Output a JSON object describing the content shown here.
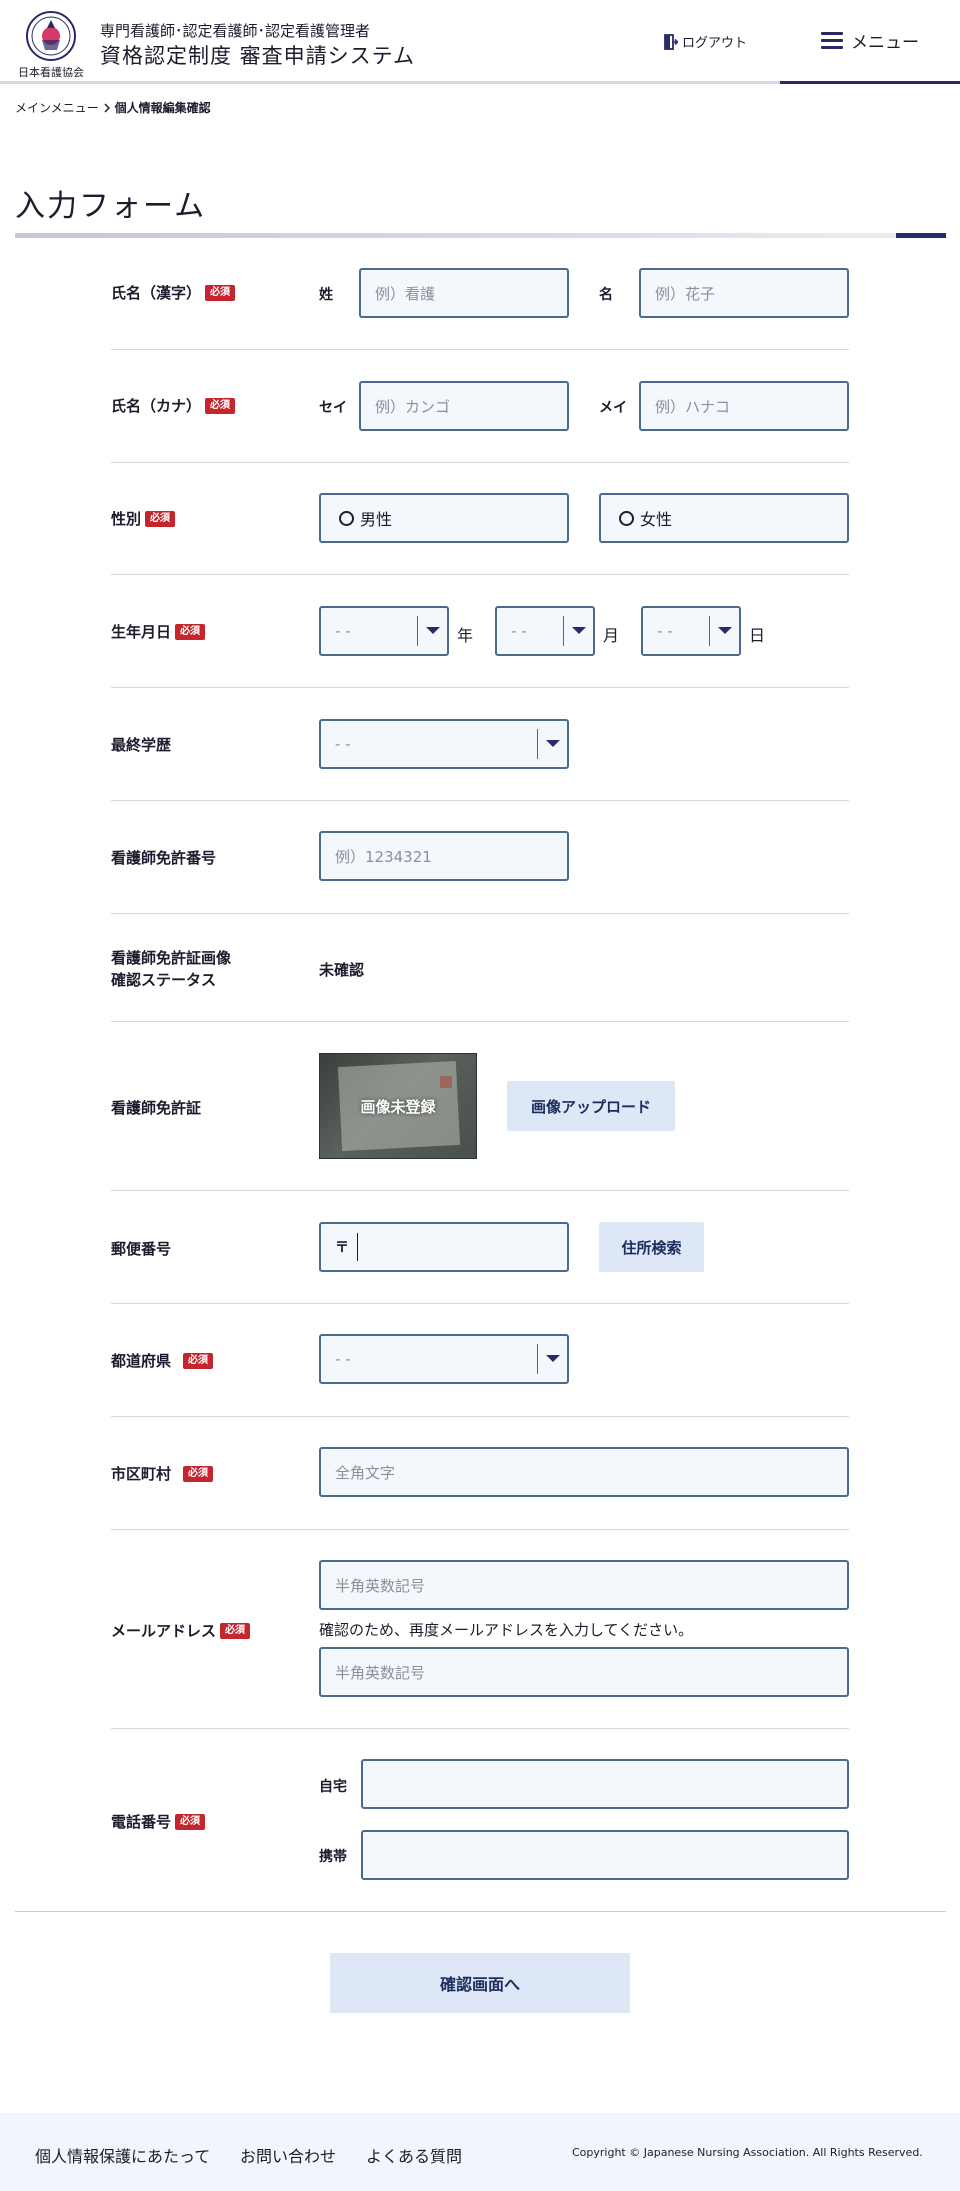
{
  "header": {
    "logo_text": "日本看護協会",
    "system_subtitle": "専門看護師･認定看護師･認定看護管理者",
    "system_title": "資格認定制度 審査申請システム",
    "logout_label": "ログアウト",
    "menu_label": "メニュー"
  },
  "breadcrumb": {
    "home": "メインメニュー",
    "current": "個人情報編集確認"
  },
  "page_title": "入力フォーム",
  "required_badge": "必須",
  "form": {
    "name_kanji": {
      "label": "氏名（漢字）",
      "last_label": "姓",
      "last_placeholder": "例）看護",
      "first_label": "名",
      "first_placeholder": "例）花子"
    },
    "name_kana": {
      "label": "氏名（カナ）",
      "last_label": "セイ",
      "last_placeholder": "例）カンゴ",
      "first_label": "メイ",
      "first_placeholder": "例）ハナコ"
    },
    "gender": {
      "label": "性別",
      "male": "男性",
      "female": "女性"
    },
    "birthdate": {
      "label": "生年月日",
      "year_value": "- -",
      "year_unit": "年",
      "month_value": "- -",
      "month_unit": "月",
      "day_value": "- -",
      "day_unit": "日"
    },
    "education": {
      "label": "最終学歴",
      "value": "- -"
    },
    "license_number": {
      "label": "看護師免許番号",
      "placeholder": "例）1234321"
    },
    "license_status": {
      "label_line1": "看護師免許証画像",
      "label_line2": "確認ステータス",
      "value": "未確認"
    },
    "license_image": {
      "label": "看護師免許証",
      "image_text": "画像未登録",
      "upload_button": "画像アップロード"
    },
    "postal": {
      "label": "郵便番号",
      "prefix": "〒",
      "search_button": "住所検索"
    },
    "prefecture": {
      "label": "都道府県",
      "value": "- -"
    },
    "city": {
      "label": "市区町村",
      "placeholder": "全角文字"
    },
    "email": {
      "label": "メールアドレス",
      "placeholder": "半角英数記号",
      "confirm_note": "確認のため、再度メールアドレスを入力してください。",
      "confirm_placeholder": "半角英数記号"
    },
    "phone": {
      "label": "電話番号",
      "home_label": "自宅",
      "mobile_label": "携帯"
    }
  },
  "confirm_button": "確認画面へ",
  "footer": {
    "links": [
      "個人情報保護にあたって",
      "お問い合わせ",
      "よくある質問"
    ],
    "copyright": "Copyright © Japanese Nursing Association. All Rights Reserved."
  },
  "colors": {
    "accent": "#2a2a6a",
    "required": "#c4262e",
    "input_border": "#4a6b8e",
    "input_bg": "#f4f7fc",
    "button_soft": "#dde7f6"
  }
}
